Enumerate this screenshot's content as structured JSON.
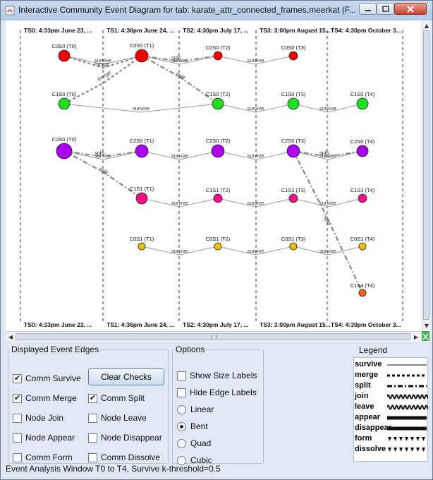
{
  "window": {
    "title": "Interactive Community Event Diagram for tab: karate_attr_connected_frames.meerkat (F..."
  },
  "timesteps": [
    {
      "label": "TS0: 4:33pm June 23, ..."
    },
    {
      "label": "TS1: 4:36pm June 24, ..."
    },
    {
      "label": "TS2: 4:30pm July 17, ..."
    },
    {
      "label": "TS3: 3:00pm August 15..."
    },
    {
      "label": "TS4: 4:30pm October 3..."
    }
  ],
  "nodes": [
    {
      "id": "C0S0 (T0)",
      "label": "C0S0 (T0)",
      "t": 0,
      "row": 0,
      "size": "medium",
      "color": "#ee0000"
    },
    {
      "id": "C0S0 (T1)",
      "label": "C0S0 (T1)",
      "t": 1,
      "row": 0,
      "size": "large",
      "color": "#ee0000"
    },
    {
      "id": "C0S0 (T2)",
      "label": "C0S0 (T2)",
      "t": 2,
      "row": 0,
      "size": "small",
      "color": "#ee0000"
    },
    {
      "id": "C0S0 (T3)",
      "label": "C0S0 (T3)",
      "t": 3,
      "row": 0,
      "size": "small",
      "color": "#ee0000"
    },
    {
      "id": "C1S0 (T0)",
      "label": "C1S0 (T0)",
      "t": 0,
      "row": 1,
      "size": "medium",
      "color": "#22dd22"
    },
    {
      "id": "C1S0 (T2)",
      "label": "C1S0 (T2)",
      "t": 2,
      "row": 1,
      "size": "medium",
      "color": "#22dd22"
    },
    {
      "id": "C1S0 (T3)",
      "label": "C1S0 (T3)",
      "t": 3,
      "row": 1,
      "size": "medium",
      "color": "#22dd22"
    },
    {
      "id": "C1S0 (T4)",
      "label": "C1S0 (T4)",
      "t": 4,
      "row": 1,
      "size": "medium",
      "color": "#22dd22"
    },
    {
      "id": "C2S0 (T0)",
      "label": "C2S0 (T0)",
      "t": 0,
      "row": 2,
      "size": "xlarge",
      "color": "#aa00ee"
    },
    {
      "id": "C2S0 (T1)",
      "label": "C2S0 (T1)",
      "t": 1,
      "row": 2,
      "size": "large",
      "color": "#aa00ee"
    },
    {
      "id": "C2S0 (T2)",
      "label": "C2S0 (T2)",
      "t": 2,
      "row": 2,
      "size": "large",
      "color": "#aa00ee"
    },
    {
      "id": "C2S0 (T3)",
      "label": "C2S0 (T3)",
      "t": 3,
      "row": 2,
      "size": "large",
      "color": "#aa00ee"
    },
    {
      "id": "C2S0 (T4)",
      "label": "C2S0 (T4)",
      "t": 4,
      "row": 2,
      "size": "medium",
      "color": "#aa00ee"
    },
    {
      "id": "C1S1 (T1)",
      "label": "C1S1 (T1)",
      "t": 1,
      "row": 3,
      "size": "medium",
      "color": "#ee1188"
    },
    {
      "id": "C1S1 (T2)",
      "label": "C1S1 (T2)",
      "t": 2,
      "row": 3,
      "size": "small",
      "color": "#ee1188"
    },
    {
      "id": "C1S1 (T3)",
      "label": "C1S1 (T3)",
      "t": 3,
      "row": 3,
      "size": "small",
      "color": "#ee1188"
    },
    {
      "id": "C1S1 (T4)",
      "label": "C1S1 (T4)",
      "t": 4,
      "row": 3,
      "size": "small",
      "color": "#ee1188"
    },
    {
      "id": "C0S1 (T1)",
      "label": "C0S1 (T1)",
      "t": 1,
      "row": 4,
      "size": "tiny",
      "color": "#f2c200"
    },
    {
      "id": "C0S1 (T2)",
      "label": "C0S1 (T2)",
      "t": 2,
      "row": 4,
      "size": "tiny",
      "color": "#f2c200"
    },
    {
      "id": "C0S1 (T3)",
      "label": "C0S1 (T3)",
      "t": 3,
      "row": 4,
      "size": "tiny",
      "color": "#f2c200"
    },
    {
      "id": "C0S1 (T4)",
      "label": "C0S1 (T4)",
      "t": 4,
      "row": 4,
      "size": "tiny",
      "color": "#f2c200"
    },
    {
      "id": "C1S4 (T4)",
      "label": "C1S4 (T4)",
      "t": 4,
      "row": 5,
      "size": "tiny",
      "color": "#ee6611"
    }
  ],
  "edges": [
    {
      "from": "C0S0 (T0)",
      "to": "C0S0 (T1)",
      "type": "survive",
      "label": "survive"
    },
    {
      "from": "C0S0 (T0)",
      "to": "C0S0 (T1)",
      "type": "merge",
      "label": "merge"
    },
    {
      "from": "C1S0 (T0)",
      "to": "C0S0 (T1)",
      "type": "merge",
      "label": "merge"
    },
    {
      "from": "C0S0 (T1)",
      "to": "C0S0 (T2)",
      "type": "survive",
      "label": "survive"
    },
    {
      "from": "C0S0 (T1)",
      "to": "C0S0 (T2)",
      "type": "split",
      "label": "split"
    },
    {
      "from": "C0S0 (T1)",
      "to": "C1S0 (T2)",
      "type": "split",
      "label": "split"
    },
    {
      "from": "C0S0 (T2)",
      "to": "C0S0 (T3)",
      "type": "survive",
      "label": "survive"
    },
    {
      "from": "C1S0 (T0)",
      "to": "C1S0 (T2)",
      "type": "survive",
      "label": "survive"
    },
    {
      "from": "C1S0 (T2)",
      "to": "C1S0 (T3)",
      "type": "survive",
      "label": "survive"
    },
    {
      "from": "C1S0 (T3)",
      "to": "C1S0 (T4)",
      "type": "survive",
      "label": "survive"
    },
    {
      "from": "C2S0 (T0)",
      "to": "C2S0 (T1)",
      "type": "survive",
      "label": "survive"
    },
    {
      "from": "C2S0 (T0)",
      "to": "C2S0 (T1)",
      "type": "split",
      "label": "split"
    },
    {
      "from": "C2S0 (T0)",
      "to": "C1S1 (T1)",
      "type": "split",
      "label": "split"
    },
    {
      "from": "C2S0 (T1)",
      "to": "C2S0 (T2)",
      "type": "survive",
      "label": "survive"
    },
    {
      "from": "C2S0 (T2)",
      "to": "C2S0 (T3)",
      "type": "survive",
      "label": "survive"
    },
    {
      "from": "C2S0 (T3)",
      "to": "C2S0 (T4)",
      "type": "survive",
      "label": "survive"
    },
    {
      "from": "C2S0 (T3)",
      "to": "C2S0 (T4)",
      "type": "split",
      "label": "split"
    },
    {
      "from": "C2S0 (T3)",
      "to": "C1S4 (T4)",
      "type": "split",
      "label": "split"
    },
    {
      "from": "C1S1 (T1)",
      "to": "C1S1 (T2)",
      "type": "survive",
      "label": "survive"
    },
    {
      "from": "C1S1 (T2)",
      "to": "C1S1 (T3)",
      "type": "survive",
      "label": "survive"
    },
    {
      "from": "C1S1 (T3)",
      "to": "C1S1 (T4)",
      "type": "survive",
      "label": "survive"
    },
    {
      "from": "C0S1 (T1)",
      "to": "C0S1 (T2)",
      "type": "survive",
      "label": "survive"
    },
    {
      "from": "C0S1 (T2)",
      "to": "C0S1 (T3)",
      "type": "survive",
      "label": "survive"
    },
    {
      "from": "C0S1 (T3)",
      "to": "C0S1 (T4)",
      "type": "survive",
      "label": "survive"
    }
  ],
  "panels": {
    "edges_title": "Displayed Event Edges",
    "options_title": "Options",
    "legend_title": "Legend",
    "clear_checks": "Clear Checks",
    "edge_checks": [
      {
        "label": "Comm Survive",
        "checked": true
      },
      {
        "label": "Comm Merge",
        "checked": true
      },
      {
        "label": "Comm Split",
        "checked": true
      },
      {
        "label": "Node Join",
        "checked": false
      },
      {
        "label": "Node Leave",
        "checked": false
      },
      {
        "label": "Node Appear",
        "checked": false
      },
      {
        "label": "Node Disappear",
        "checked": false
      },
      {
        "label": "Comm Form",
        "checked": false
      },
      {
        "label": "Comm Dissolve",
        "checked": false
      }
    ],
    "option_checks": [
      {
        "label": "Show Size Labels",
        "checked": false
      },
      {
        "label": "Hide Edge Labels",
        "checked": false
      }
    ],
    "radios": [
      {
        "label": "Linear",
        "selected": false
      },
      {
        "label": "Bent",
        "selected": true
      },
      {
        "label": "Quad",
        "selected": false
      },
      {
        "label": "Cubic",
        "selected": false
      }
    ],
    "legend": [
      {
        "label": "survive",
        "style": "thin-solid"
      },
      {
        "label": "merge",
        "style": "dashed"
      },
      {
        "label": "split",
        "style": "dash-dot"
      },
      {
        "label": "join",
        "style": "wave"
      },
      {
        "label": "leave",
        "style": "wave"
      },
      {
        "label": "appear",
        "style": "thick-solid"
      },
      {
        "label": "disappear",
        "style": "thick-solid"
      },
      {
        "label": "form",
        "style": "triangles"
      },
      {
        "label": "dissolve",
        "style": "triangles"
      }
    ]
  },
  "status": "Event Analysis Window T0 to T4, Survive k-threshold=0.5",
  "colors": {
    "accent": "#3b6cb5",
    "titlebar": "#c9daf0",
    "close": "#c8432f"
  }
}
